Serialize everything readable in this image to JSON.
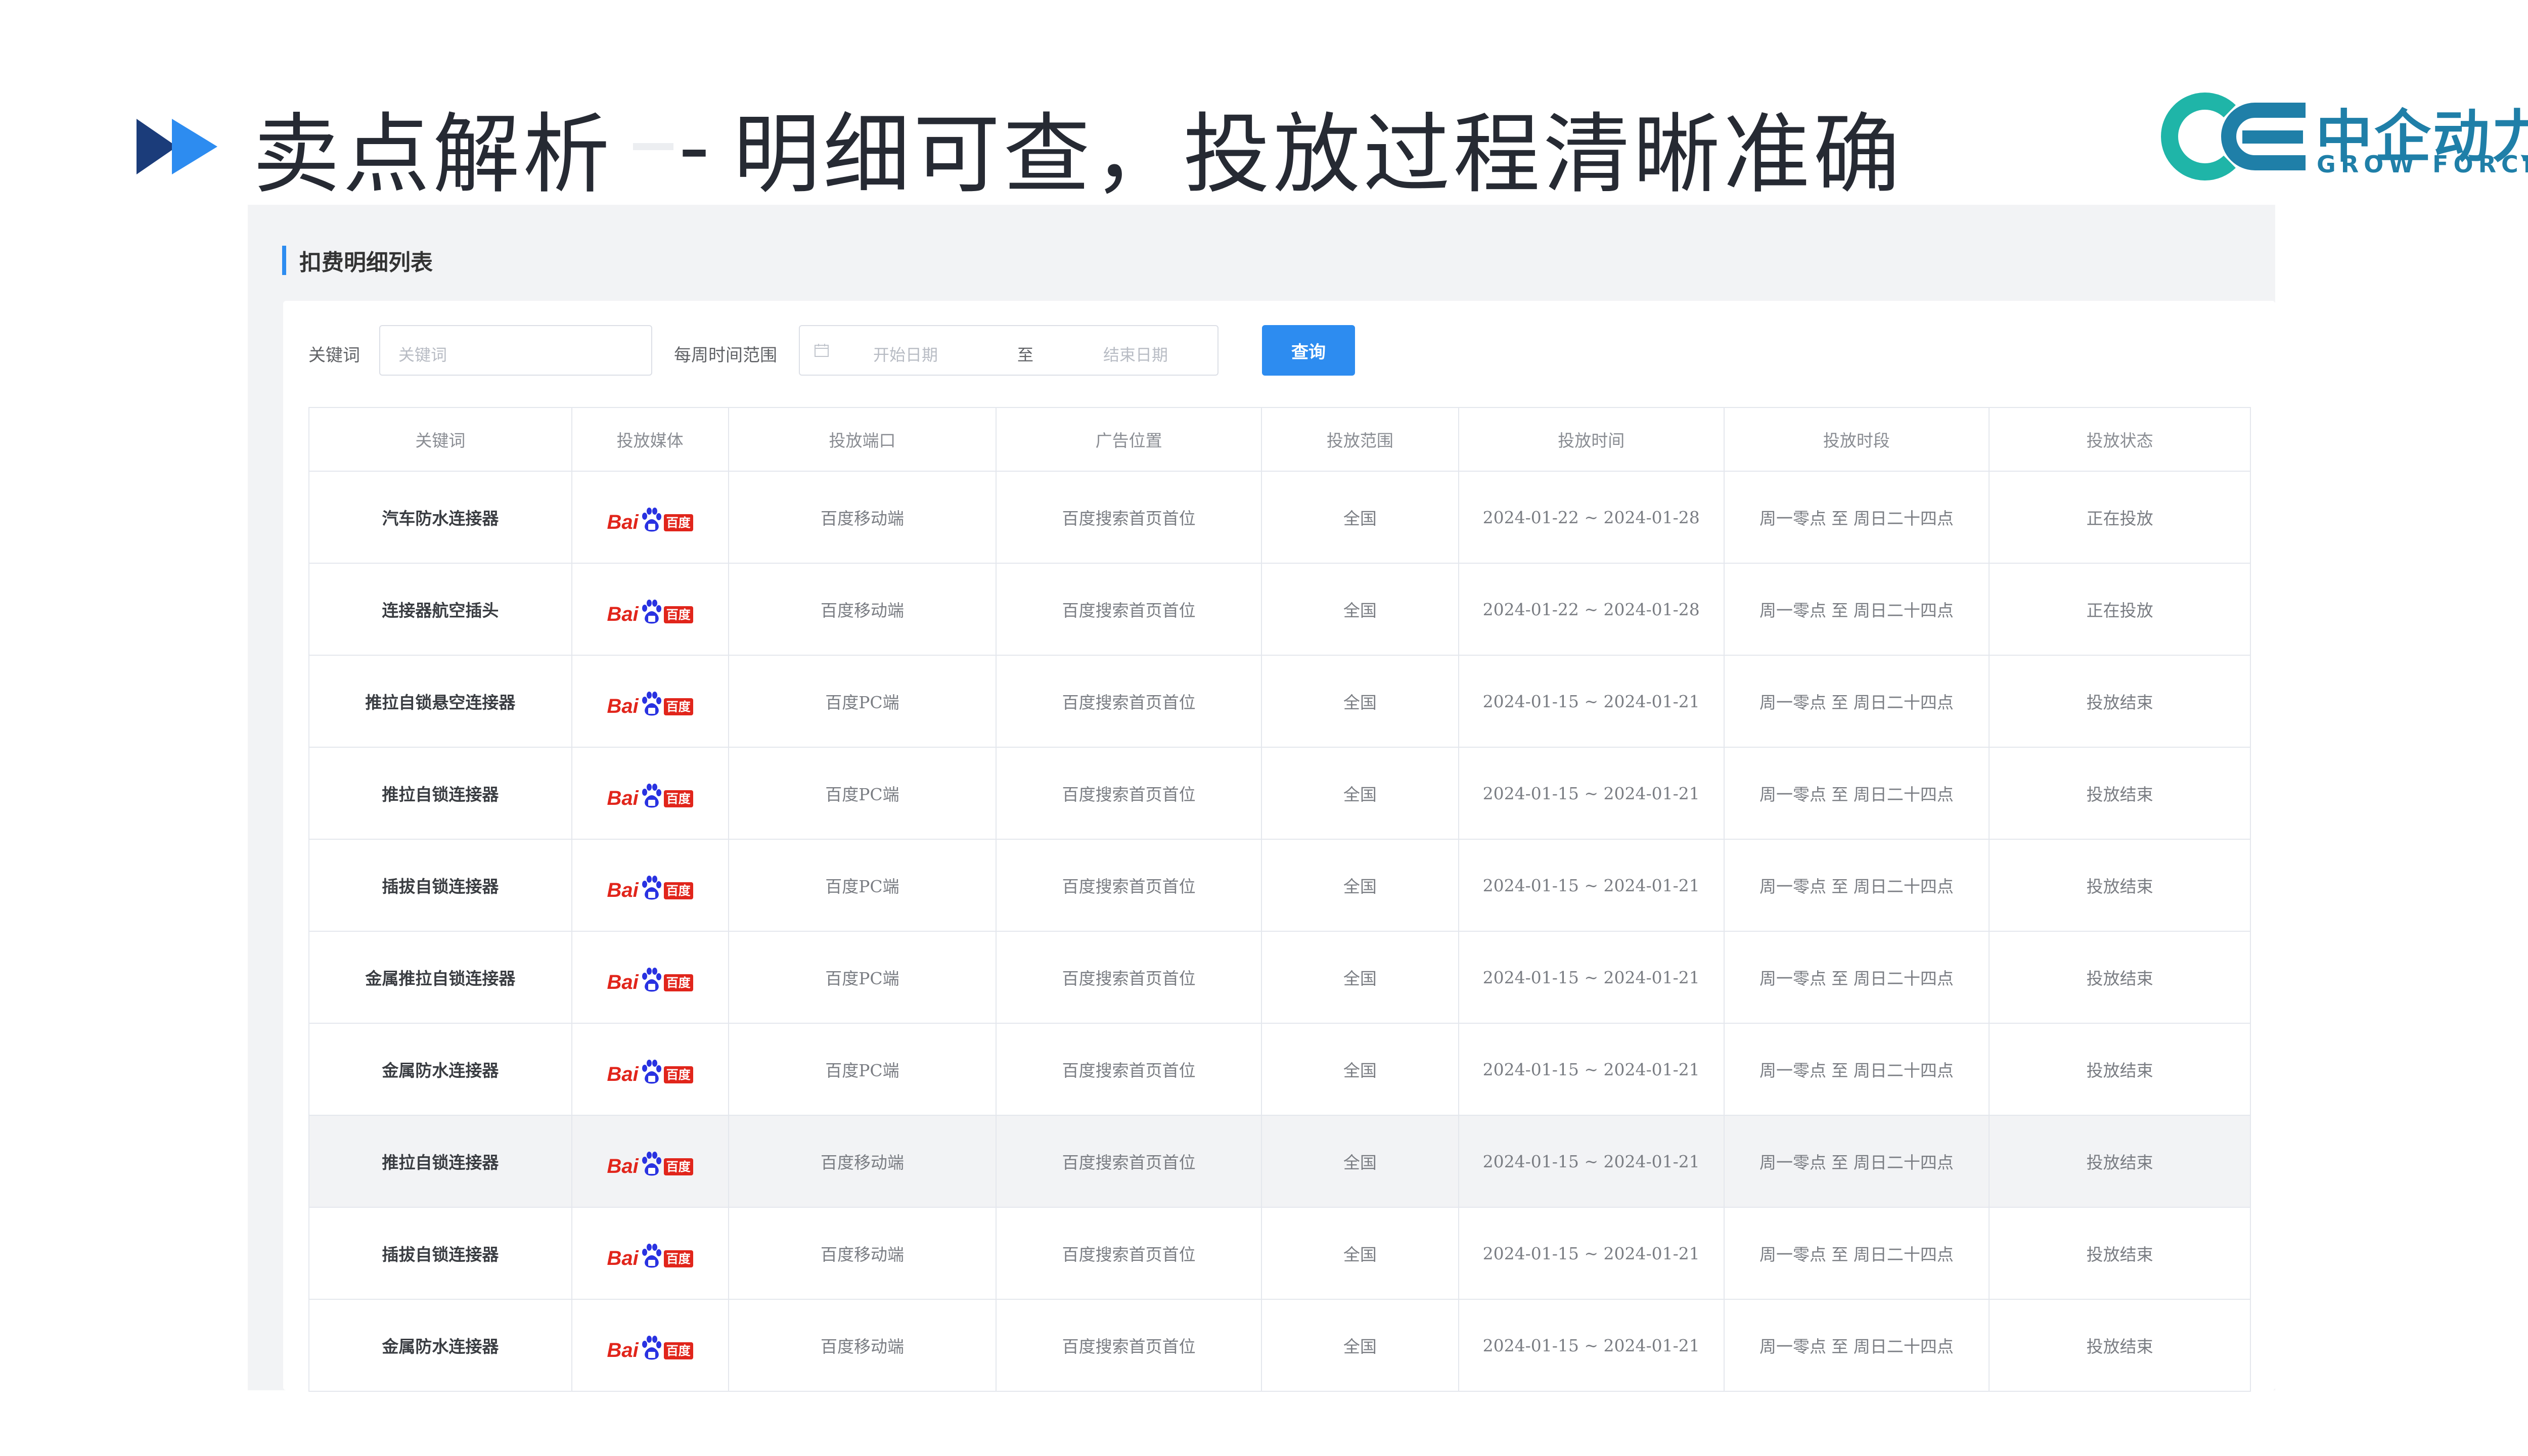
{
  "slide": {
    "title": "卖点解析",
    "title_sep": "-",
    "subtitle": "明细可查，投放过程清晰准确"
  },
  "logo": {
    "cn": "中企动力",
    "en": "GROW FORCE",
    "mark": "CE"
  },
  "panel": {
    "title": "扣费明细列表",
    "filters": {
      "keyword_label": "关键词",
      "keyword_placeholder": "关键词",
      "date_label": "每周时间范围",
      "start_placeholder": "开始日期",
      "to": "至",
      "end_placeholder": "结束日期",
      "query_button": "查询"
    }
  },
  "table": {
    "headers": [
      "关键词",
      "投放媒体",
      "投放端口",
      "广告位置",
      "投放范围",
      "投放时间",
      "投放时段",
      "投放状态"
    ],
    "media_logo": {
      "bai": "Bai",
      "du": "百度"
    },
    "rows": [
      {
        "keyword": "汽车防水连接器",
        "port": "百度移动端",
        "position": "百度搜索首页首位",
        "range": "全国",
        "time": "2024-01-22 ~ 2024-01-28",
        "period": "周一零点 至 周日二十四点",
        "status": "正在投放"
      },
      {
        "keyword": "连接器航空插头",
        "port": "百度移动端",
        "position": "百度搜索首页首位",
        "range": "全国",
        "time": "2024-01-22 ~ 2024-01-28",
        "period": "周一零点 至 周日二十四点",
        "status": "正在投放"
      },
      {
        "keyword": "推拉自锁悬空连接器",
        "port": "百度PC端",
        "position": "百度搜索首页首位",
        "range": "全国",
        "time": "2024-01-15 ~ 2024-01-21",
        "period": "周一零点 至 周日二十四点",
        "status": "投放结束"
      },
      {
        "keyword": "推拉自锁连接器",
        "port": "百度PC端",
        "position": "百度搜索首页首位",
        "range": "全国",
        "time": "2024-01-15 ~ 2024-01-21",
        "period": "周一零点 至 周日二十四点",
        "status": "投放结束"
      },
      {
        "keyword": "插拔自锁连接器",
        "port": "百度PC端",
        "position": "百度搜索首页首位",
        "range": "全国",
        "time": "2024-01-15 ~ 2024-01-21",
        "period": "周一零点 至 周日二十四点",
        "status": "投放结束"
      },
      {
        "keyword": "金属推拉自锁连接器",
        "port": "百度PC端",
        "position": "百度搜索首页首位",
        "range": "全国",
        "time": "2024-01-15 ~ 2024-01-21",
        "period": "周一零点 至 周日二十四点",
        "status": "投放结束"
      },
      {
        "keyword": "金属防水连接器",
        "port": "百度PC端",
        "position": "百度搜索首页首位",
        "range": "全国",
        "time": "2024-01-15 ~ 2024-01-21",
        "period": "周一零点 至 周日二十四点",
        "status": "投放结束"
      },
      {
        "keyword": "推拉自锁连接器",
        "port": "百度移动端",
        "position": "百度搜索首页首位",
        "range": "全国",
        "time": "2024-01-15 ~ 2024-01-21",
        "period": "周一零点 至 周日二十四点",
        "status": "投放结束"
      },
      {
        "keyword": "插拔自锁连接器",
        "port": "百度移动端",
        "position": "百度搜索首页首位",
        "range": "全国",
        "time": "2024-01-15 ~ 2024-01-21",
        "period": "周一零点 至 周日二十四点",
        "status": "投放结束"
      },
      {
        "keyword": "金属防水连接器",
        "port": "百度移动端",
        "position": "百度搜索首页首位",
        "range": "全国",
        "time": "2024-01-15 ~ 2024-01-21",
        "period": "周一零点 至 周日二十四点",
        "status": "投放结束"
      }
    ]
  },
  "colors": {
    "accent": "#2d8cf0",
    "title_arrow": "#1b3c7a",
    "title_arrow_light": "#2d8cf0",
    "baidu_red": "#e1251b",
    "baidu_blue": "#2932e1",
    "logo_teal": "#1fb5a8",
    "logo_blue": "#1f7fa8",
    "row_highlight": "#f2f3f5"
  }
}
